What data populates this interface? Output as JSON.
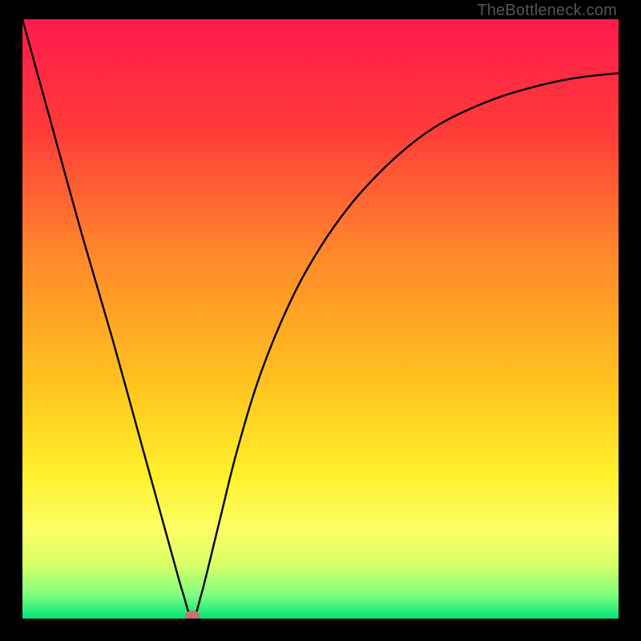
{
  "attribution": "TheBottleneck.com",
  "chart_data": {
    "type": "line",
    "title": "",
    "xlabel": "",
    "ylabel": "",
    "xlim": [
      0,
      100
    ],
    "ylim": [
      0,
      100
    ],
    "grid": false,
    "legend": false,
    "series": [
      {
        "name": "bottleneck-curve",
        "x": [
          0,
          5,
          10,
          15,
          20,
          25,
          27,
          28.5,
          30,
          33,
          36,
          40,
          45,
          50,
          55,
          60,
          65,
          70,
          75,
          80,
          85,
          90,
          95,
          100
        ],
        "values": [
          100,
          82,
          64,
          47,
          29,
          11,
          4,
          0,
          4,
          16,
          28,
          41,
          53,
          62,
          69,
          74.5,
          79,
          82.5,
          85,
          87,
          88.5,
          89.7,
          90.5,
          91
        ]
      }
    ],
    "marker": {
      "x": 28.5,
      "y": 0,
      "color": "#cc6f6f",
      "shape": "ellipse"
    },
    "background_gradient": {
      "stops": [
        {
          "offset": 0.0,
          "color": "#ff1a4d"
        },
        {
          "offset": 0.18,
          "color": "#ff3a3a"
        },
        {
          "offset": 0.4,
          "color": "#ff8a2a"
        },
        {
          "offset": 0.6,
          "color": "#ffc11f"
        },
        {
          "offset": 0.76,
          "color": "#fff02a"
        },
        {
          "offset": 0.85,
          "color": "#fcff66"
        },
        {
          "offset": 0.91,
          "color": "#d9ff66"
        },
        {
          "offset": 0.96,
          "color": "#80ff80"
        },
        {
          "offset": 1.0,
          "color": "#00e676"
        }
      ]
    }
  }
}
